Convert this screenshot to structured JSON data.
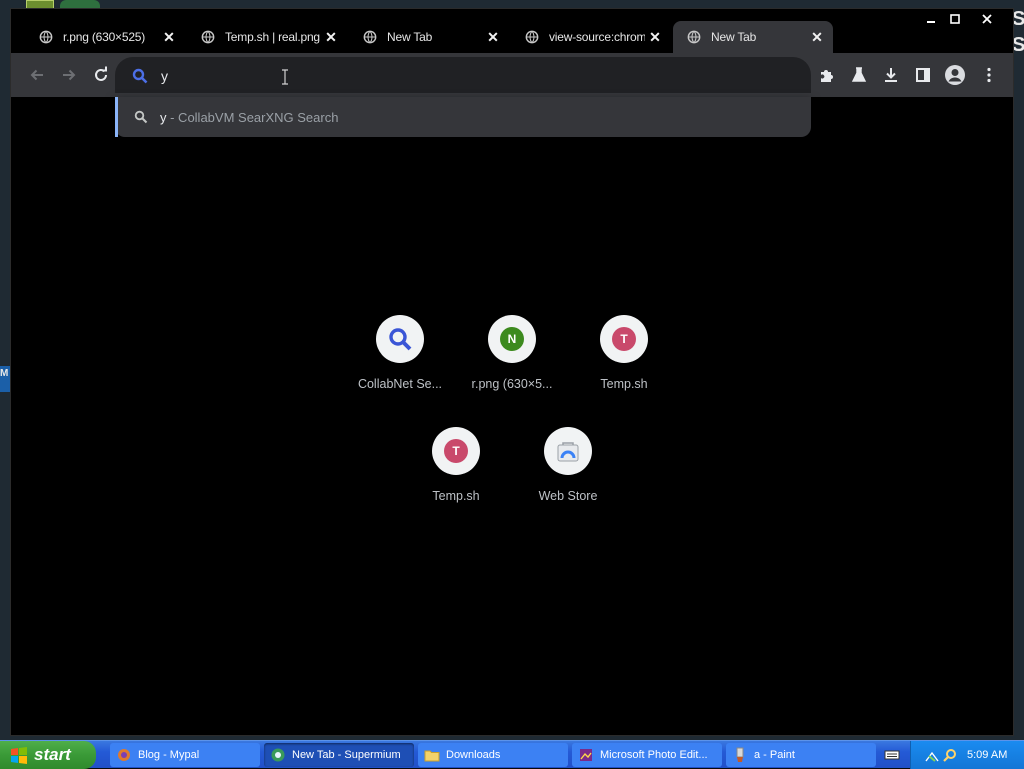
{
  "browser": {
    "tabs": [
      {
        "title": "r.png (630×525)",
        "active": false
      },
      {
        "title": "Temp.sh | real.png",
        "active": false
      },
      {
        "title": "New Tab",
        "active": false
      },
      {
        "title": "view-source:chrome://",
        "active": false
      },
      {
        "title": "New Tab",
        "active": true
      }
    ],
    "omnibox": {
      "value": "y"
    },
    "suggestion": {
      "query": "y",
      "text": " - CollabVM SearXNG Search"
    },
    "shortcuts": [
      {
        "label": "CollabNet Se...",
        "icon": "magnifier-icon"
      },
      {
        "label": "r.png (630×5...",
        "letter": "N",
        "color": "#3c8a1e"
      },
      {
        "label": "Temp.sh",
        "letter": "T",
        "color": "#c9496b"
      },
      {
        "label": "Temp.sh",
        "letter": "T",
        "color": "#c9496b"
      },
      {
        "label": "Web Store",
        "icon": "web-store-icon"
      }
    ]
  },
  "taskbar": {
    "start_label": "start",
    "tasks": [
      {
        "label": "Blog - Mypal",
        "active": false
      },
      {
        "label": "New Tab - Supermium",
        "active": true
      },
      {
        "label": "Downloads",
        "active": false
      },
      {
        "label": "Microsoft Photo Edit...",
        "active": false
      },
      {
        "label": "a - Paint",
        "active": false
      }
    ],
    "clock": "5:09 AM"
  },
  "desktop": {
    "fragments": [
      "S",
      "S",
      "M"
    ]
  }
}
